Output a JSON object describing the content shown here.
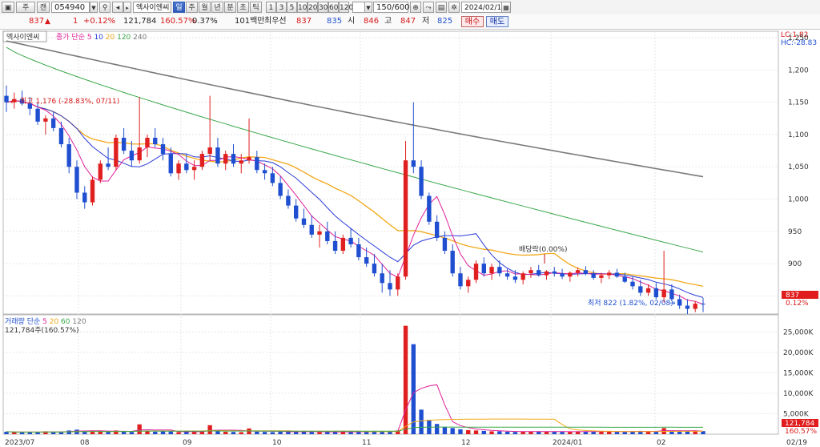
{
  "toolbar": {
    "view_btn1": "▣",
    "view_btn2": "주",
    "mode_btn": "캔",
    "stock_code": "054940",
    "stock_name": "엑사이엔씨",
    "periods": [
      "일",
      "주",
      "월",
      "년",
      "분",
      "초",
      "틱"
    ],
    "active_period": "일",
    "minutes": [
      "1",
      "3",
      "5",
      "10",
      "20",
      "30",
      "60",
      "120"
    ],
    "view_range": "150/600",
    "date": "2024/02/19"
  },
  "quote": {
    "price": "837",
    "change_arrow": "▲",
    "change": "1",
    "change_rate": "+0.12%",
    "volume": "121,784",
    "volume_rate": "160.57%",
    "turnover_rate": "0.37%",
    "amount": "101백만",
    "preferred_label": "최우선",
    "ask": "837",
    "bid": "835",
    "open_label": "시",
    "open": "846",
    "high_label": "고",
    "high": "847",
    "low_label": "저",
    "low": "825",
    "buy_btn": "매수",
    "sell_btn": "매도"
  },
  "price_panel": {
    "title": "엑사이엔씨",
    "legend_prefix": "종가 단순",
    "ma_labels": [
      "5",
      "10",
      "20",
      "120",
      "240"
    ],
    "ma_colors": [
      "#e0209a",
      "#2b3cd8",
      "#f2a81a",
      "#3aa84a",
      "#7a7a7a"
    ],
    "lc_label": "LC:1.82",
    "hc_label": "HC:-28.83",
    "y_ticks": [
      "1,250",
      "1,200",
      "1,150",
      "1,100",
      "1,050",
      "1,000",
      "950",
      "900",
      "850"
    ],
    "high_note": "최고 1,176 (-28.83%, 07/11)",
    "low_note": "최저 822 (1.82%, 02/08)",
    "dividend_note": "배당락(0.00%)",
    "price_tag": "837",
    "pct_tag": "0.12%"
  },
  "volume_panel": {
    "legend_prefix": "거래량 단순",
    "ma_labels": [
      "5",
      "20",
      "60",
      "120"
    ],
    "ma_colors": [
      "#e0209a",
      "#f2a81a",
      "#3aa84a",
      "#7a7a7a"
    ],
    "value_label": "121,784주(160.57%)",
    "y_ticks": [
      "25,000K",
      "20,000K",
      "15,000K",
      "10,000K",
      "5,000K"
    ],
    "vol_tag": "121,784",
    "vol_pct_tag": "160.57%"
  },
  "x_axis": {
    "labels": [
      "2023/07",
      "08",
      "09",
      "10",
      "11",
      "12",
      "2024/01",
      "02",
      "02/19"
    ]
  },
  "colors": {
    "up": "#e02020",
    "down": "#1f4fd0",
    "accent": "#2e5bb8"
  },
  "chart_data": {
    "type": "candlestick",
    "price_ylim": [
      822,
      1260
    ],
    "volume_ylim": [
      0,
      28000
    ],
    "candles": [
      [
        1160,
        1176,
        1135,
        1150
      ],
      [
        1150,
        1165,
        1140,
        1155
      ],
      [
        1155,
        1168,
        1145,
        1148
      ],
      [
        1148,
        1158,
        1130,
        1140
      ],
      [
        1140,
        1150,
        1115,
        1120
      ],
      [
        1120,
        1130,
        1100,
        1125
      ],
      [
        1125,
        1135,
        1105,
        1110
      ],
      [
        1110,
        1120,
        1080,
        1085
      ],
      [
        1085,
        1095,
        1040,
        1050
      ],
      [
        1050,
        1060,
        1000,
        1010
      ],
      [
        1010,
        1020,
        985,
        995
      ],
      [
        995,
        1035,
        990,
        1030
      ],
      [
        1030,
        1060,
        1025,
        1055
      ],
      [
        1055,
        1080,
        1045,
        1050
      ],
      [
        1050,
        1100,
        1045,
        1095
      ],
      [
        1095,
        1110,
        1070,
        1075
      ],
      [
        1075,
        1090,
        1050,
        1060
      ],
      [
        1060,
        1158,
        1055,
        1080
      ],
      [
        1080,
        1100,
        1065,
        1095
      ],
      [
        1095,
        1110,
        1080,
        1085
      ],
      [
        1085,
        1095,
        1060,
        1070
      ],
      [
        1070,
        1080,
        1035,
        1040
      ],
      [
        1040,
        1060,
        1030,
        1055
      ],
      [
        1055,
        1070,
        1040,
        1045
      ],
      [
        1045,
        1060,
        1030,
        1050
      ],
      [
        1050,
        1075,
        1045,
        1070
      ],
      [
        1070,
        1160,
        1060,
        1080
      ],
      [
        1080,
        1095,
        1050,
        1055
      ],
      [
        1055,
        1075,
        1045,
        1070
      ],
      [
        1070,
        1085,
        1050,
        1055
      ],
      [
        1055,
        1070,
        1040,
        1060
      ],
      [
        1060,
        1125,
        1055,
        1065
      ],
      [
        1065,
        1075,
        1040,
        1045
      ],
      [
        1045,
        1055,
        1030,
        1040
      ],
      [
        1040,
        1050,
        1020,
        1025
      ],
      [
        1025,
        1035,
        1000,
        1005
      ],
      [
        1005,
        1015,
        985,
        990
      ],
      [
        990,
        1000,
        965,
        970
      ],
      [
        970,
        985,
        955,
        960
      ],
      [
        960,
        975,
        940,
        945
      ],
      [
        945,
        960,
        925,
        950
      ],
      [
        950,
        965,
        930,
        935
      ],
      [
        935,
        950,
        915,
        920
      ],
      [
        920,
        945,
        915,
        940
      ],
      [
        940,
        955,
        925,
        930
      ],
      [
        930,
        940,
        905,
        910
      ],
      [
        910,
        925,
        895,
        900
      ],
      [
        900,
        915,
        880,
        885
      ],
      [
        885,
        900,
        855,
        870
      ],
      [
        870,
        890,
        850,
        860
      ],
      [
        860,
        885,
        850,
        880
      ],
      [
        880,
        1090,
        875,
        1060
      ],
      [
        1060,
        1150,
        1040,
        1050
      ],
      [
        1050,
        1060,
        1000,
        1005
      ],
      [
        1005,
        1010,
        960,
        965
      ],
      [
        965,
        975,
        935,
        940
      ],
      [
        940,
        950,
        915,
        920
      ],
      [
        920,
        930,
        880,
        885
      ],
      [
        885,
        895,
        860,
        865
      ],
      [
        865,
        880,
        855,
        875
      ],
      [
        875,
        905,
        870,
        900
      ],
      [
        900,
        910,
        880,
        885
      ],
      [
        885,
        900,
        875,
        895
      ],
      [
        895,
        905,
        880,
        885
      ],
      [
        885,
        892,
        875,
        880
      ],
      [
        880,
        890,
        870,
        875
      ],
      [
        875,
        888,
        868,
        885
      ],
      [
        885,
        895,
        878,
        890
      ],
      [
        890,
        898,
        880,
        882
      ],
      [
        882,
        890,
        875,
        888
      ],
      [
        888,
        895,
        880,
        885
      ],
      [
        885,
        892,
        876,
        880
      ],
      [
        880,
        888,
        872,
        886
      ],
      [
        886,
        894,
        880,
        890
      ],
      [
        890,
        896,
        882,
        884
      ],
      [
        884,
        890,
        875,
        878
      ],
      [
        878,
        886,
        870,
        882
      ],
      [
        882,
        890,
        876,
        886
      ],
      [
        886,
        892,
        878,
        880
      ],
      [
        880,
        886,
        870,
        872
      ],
      [
        872,
        880,
        860,
        865
      ],
      [
        865,
        875,
        850,
        855
      ],
      [
        855,
        868,
        850,
        862
      ],
      [
        862,
        870,
        845,
        848
      ],
      [
        848,
        920,
        840,
        860
      ],
      [
        860,
        868,
        842,
        845
      ],
      [
        845,
        852,
        830,
        835
      ],
      [
        835,
        845,
        822,
        830
      ],
      [
        830,
        842,
        825,
        838
      ],
      [
        838,
        847,
        825,
        837
      ]
    ],
    "volumes": [
      600,
      500,
      450,
      520,
      480,
      700,
      500,
      650,
      900,
      1100,
      800,
      700,
      650,
      600,
      900,
      700,
      550,
      2400,
      800,
      600,
      700,
      650,
      500,
      600,
      550,
      700,
      2200,
      800,
      600,
      550,
      500,
      1400,
      600,
      550,
      500,
      600,
      650,
      700,
      600,
      550,
      500,
      600,
      550,
      650,
      500,
      600,
      700,
      800,
      750,
      600,
      900,
      26500,
      22000,
      6000,
      3500,
      2500,
      1800,
      1500,
      1200,
      1000,
      900,
      800,
      700,
      700,
      600,
      550,
      600,
      650,
      700,
      600,
      600,
      550,
      600,
      700,
      650,
      600,
      650,
      700,
      650,
      600,
      700,
      800,
      700,
      650,
      1500,
      700,
      600,
      800,
      700,
      750
    ],
    "ma_price_series": [
      "5",
      "10",
      "20",
      "120",
      "240"
    ],
    "ma_volume_series": [
      "5",
      "20",
      "60",
      "120"
    ]
  }
}
